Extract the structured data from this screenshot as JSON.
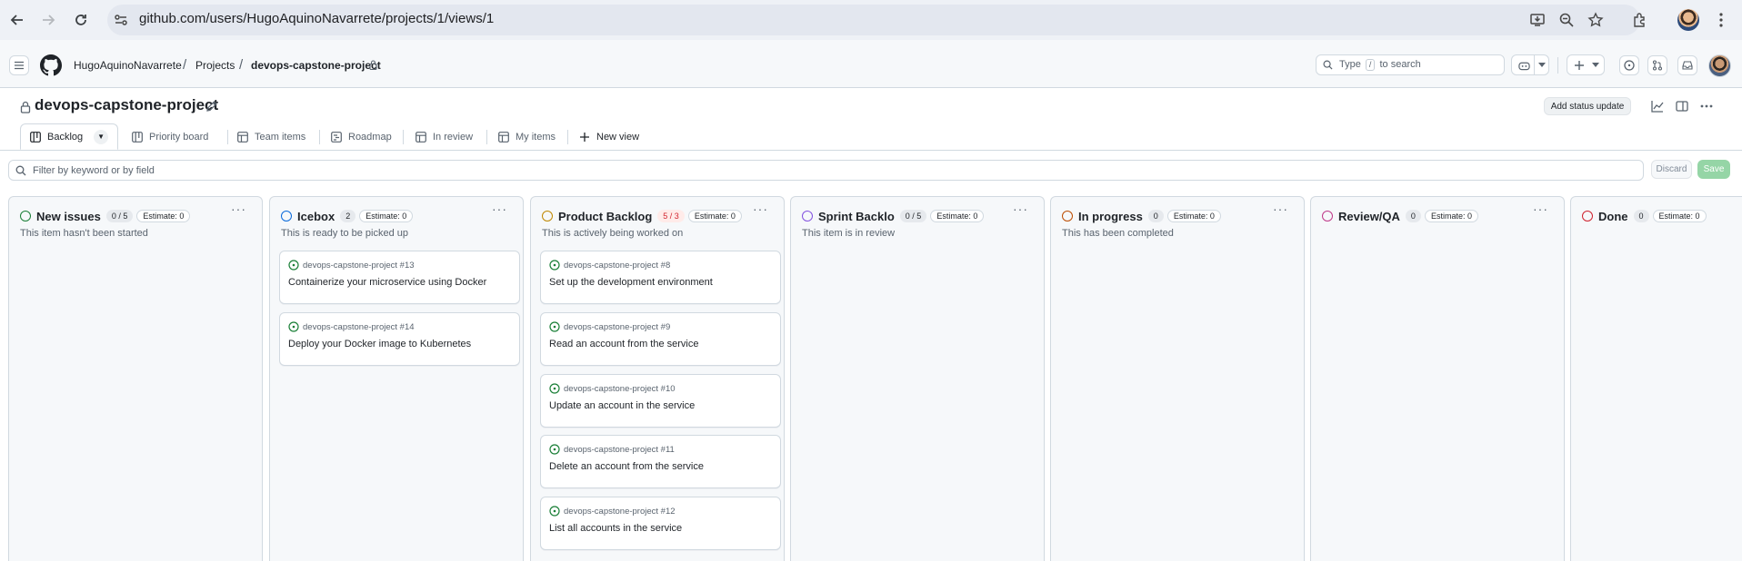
{
  "browser": {
    "url": "github.com/users/HugoAquinoNavarrete/projects/1/views/1",
    "back_icon": "arrow-left-icon",
    "forward_icon": "arrow-right-icon",
    "reload_icon": "reload-icon"
  },
  "header": {
    "breadcrumbs": [
      "HugoAquinoNavarrete",
      "Projects",
      "devops-capstone-project"
    ],
    "search_prefix": "Type",
    "search_key": "/",
    "search_suffix": "to search"
  },
  "project": {
    "title": "devops-capstone-project",
    "status_update_label": "Add status update"
  },
  "views": [
    {
      "label": "Backlog",
      "icon": "board-icon",
      "active": true
    },
    {
      "label": "Priority board",
      "icon": "board-icon"
    },
    {
      "label": "Team items",
      "icon": "table-icon"
    },
    {
      "label": "Roadmap",
      "icon": "roadmap-icon"
    },
    {
      "label": "In review",
      "icon": "table-icon"
    },
    {
      "label": "My items",
      "icon": "table-icon"
    }
  ],
  "new_view_label": "New view",
  "filter": {
    "placeholder": "Filter by keyword or by field",
    "discard_label": "Discard",
    "save_label": "Save"
  },
  "colors": {
    "open_issue": "#1a7f37",
    "new_issues": "#1a7f37",
    "icebox": "#0969da",
    "product_backlog": "#bf8700",
    "sprint_backlog": "#8250df",
    "in_progress": "#bc4c00",
    "review_qa": "#bf3989",
    "done": "#cf222e"
  },
  "columns": [
    {
      "name": "New issues",
      "count": "0 / 5",
      "over_limit": false,
      "estimate": "Estimate: 0",
      "description": "This item hasn't been started",
      "color": "#1a7f37",
      "cards": []
    },
    {
      "name": "Icebox",
      "count": "2",
      "over_limit": false,
      "estimate": "Estimate: 0",
      "description": "This is ready to be picked up",
      "color": "#0969da",
      "cards": [
        {
          "repo": "devops-capstone-project #13",
          "title": "Containerize your microservice using Docker"
        },
        {
          "repo": "devops-capstone-project #14",
          "title": "Deploy your Docker image to Kubernetes"
        }
      ]
    },
    {
      "name": "Product Backlog",
      "count": "5 / 3",
      "over_limit": true,
      "estimate": "Estimate: 0",
      "description": "This is actively being worked on",
      "color": "#bf8700",
      "cards": [
        {
          "repo": "devops-capstone-project #8",
          "title": "Set up the development environment"
        },
        {
          "repo": "devops-capstone-project #9",
          "title": "Read an account from the service"
        },
        {
          "repo": "devops-capstone-project #10",
          "title": "Update an account in the service"
        },
        {
          "repo": "devops-capstone-project #11",
          "title": "Delete an account from the service"
        },
        {
          "repo": "devops-capstone-project #12",
          "title": "List all accounts in the service"
        }
      ]
    },
    {
      "name": "Sprint Backlo",
      "count": "0 / 5",
      "over_limit": false,
      "estimate": "Estimate: 0",
      "description": "This item is in review",
      "color": "#8250df",
      "cards": []
    },
    {
      "name": "In progress",
      "count": "0",
      "over_limit": false,
      "estimate": "Estimate: 0",
      "description": "This has been completed",
      "color": "#bc4c00",
      "cards": []
    },
    {
      "name": "Review/QA",
      "count": "0",
      "over_limit": false,
      "estimate": "Estimate: 0",
      "description": "",
      "color": "#bf3989",
      "cards": []
    },
    {
      "name": "Done",
      "count": "0",
      "over_limit": false,
      "estimate": "Estimate: 0",
      "description": "",
      "color": "#cf222e",
      "cards": []
    }
  ]
}
